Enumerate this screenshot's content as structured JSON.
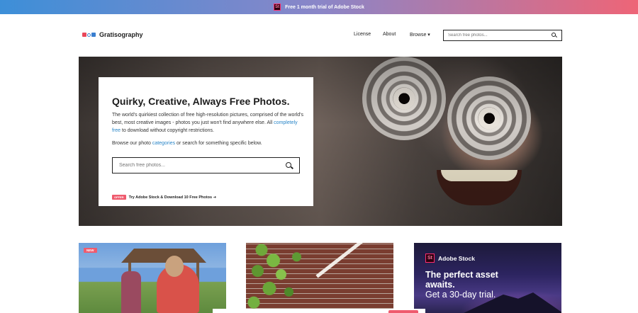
{
  "promo": {
    "badge": "St",
    "text": "Free 1 month trial of Adobe Stock"
  },
  "header": {
    "logo_text": "Gratisography",
    "nav": [
      {
        "label": "License"
      },
      {
        "label": "About"
      },
      {
        "label": "Browse ▾"
      }
    ],
    "search_placeholder": "Search free photos..."
  },
  "hero": {
    "title": "Quirky, Creative, Always Free Photos.",
    "desc_1": "The world's quirkiest collection of free high-resolution pictures, comprised of the world's best, most creative images - photos you just won't find anywhere else. All ",
    "desc_link": "completely free",
    "desc_2": " to download without copyright restrictions.",
    "browse_1": "Browse our photo ",
    "browse_link": "categories",
    "browse_2": " or search for something specific below.",
    "search_placeholder": "Search free photos...",
    "offer_badge": "OFFER",
    "offer_text": "Try Adobe Stock & Download 10 Free Photos ➜"
  },
  "thumbs": {
    "new_badge": "NEW",
    "stock_brand": "Adobe Stock",
    "stock_brand_badge": "St",
    "stock_headline": "The perfect asset awaits.",
    "stock_sub": "Get a 30-day trial."
  }
}
